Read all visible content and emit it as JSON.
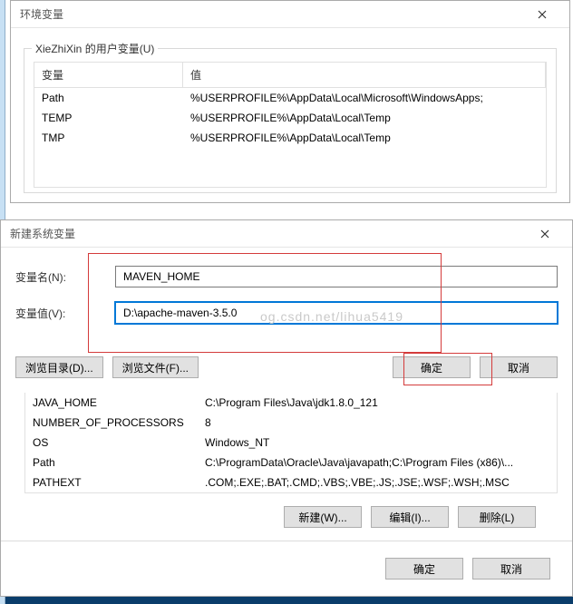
{
  "env_dialog": {
    "title": "环境变量",
    "user_group_label": "XieZhiXin 的用户变量(U)",
    "columns": {
      "var": "变量",
      "val": "值"
    },
    "rows": [
      {
        "var": "Path",
        "val": "%USERPROFILE%\\AppData\\Local\\Microsoft\\WindowsApps;"
      },
      {
        "var": "TEMP",
        "val": "%USERPROFILE%\\AppData\\Local\\Temp"
      },
      {
        "var": "TMP",
        "val": "%USERPROFILE%\\AppData\\Local\\Temp"
      }
    ]
  },
  "newvar_dialog": {
    "title": "新建系统变量",
    "name_label": "变量名(N):",
    "name_value": "MAVEN_HOME",
    "value_label": "变量值(V):",
    "value_value": "D:\\apache-maven-3.5.0",
    "browse_dir": "浏览目录(D)...",
    "browse_file": "浏览文件(F)...",
    "ok": "确定",
    "cancel": "取消",
    "watermark": "og.csdn.net/lihua5419"
  },
  "sys_table": {
    "rows": [
      {
        "var": "JAVA_HOME",
        "val": "C:\\Program Files\\Java\\jdk1.8.0_121"
      },
      {
        "var": "NUMBER_OF_PROCESSORS",
        "val": "8"
      },
      {
        "var": "OS",
        "val": "Windows_NT"
      },
      {
        "var": "Path",
        "val": "C:\\ProgramData\\Oracle\\Java\\javapath;C:\\Program Files (x86)\\..."
      },
      {
        "var": "PATHEXT",
        "val": ".COM;.EXE;.BAT;.CMD;.VBS;.VBE;.JS;.JSE;.WSF;.WSH;.MSC"
      }
    ],
    "new_btn": "新建(W)...",
    "edit_btn": "编辑(I)...",
    "delete_btn": "删除(L)",
    "ok": "确定",
    "cancel": "取消"
  }
}
